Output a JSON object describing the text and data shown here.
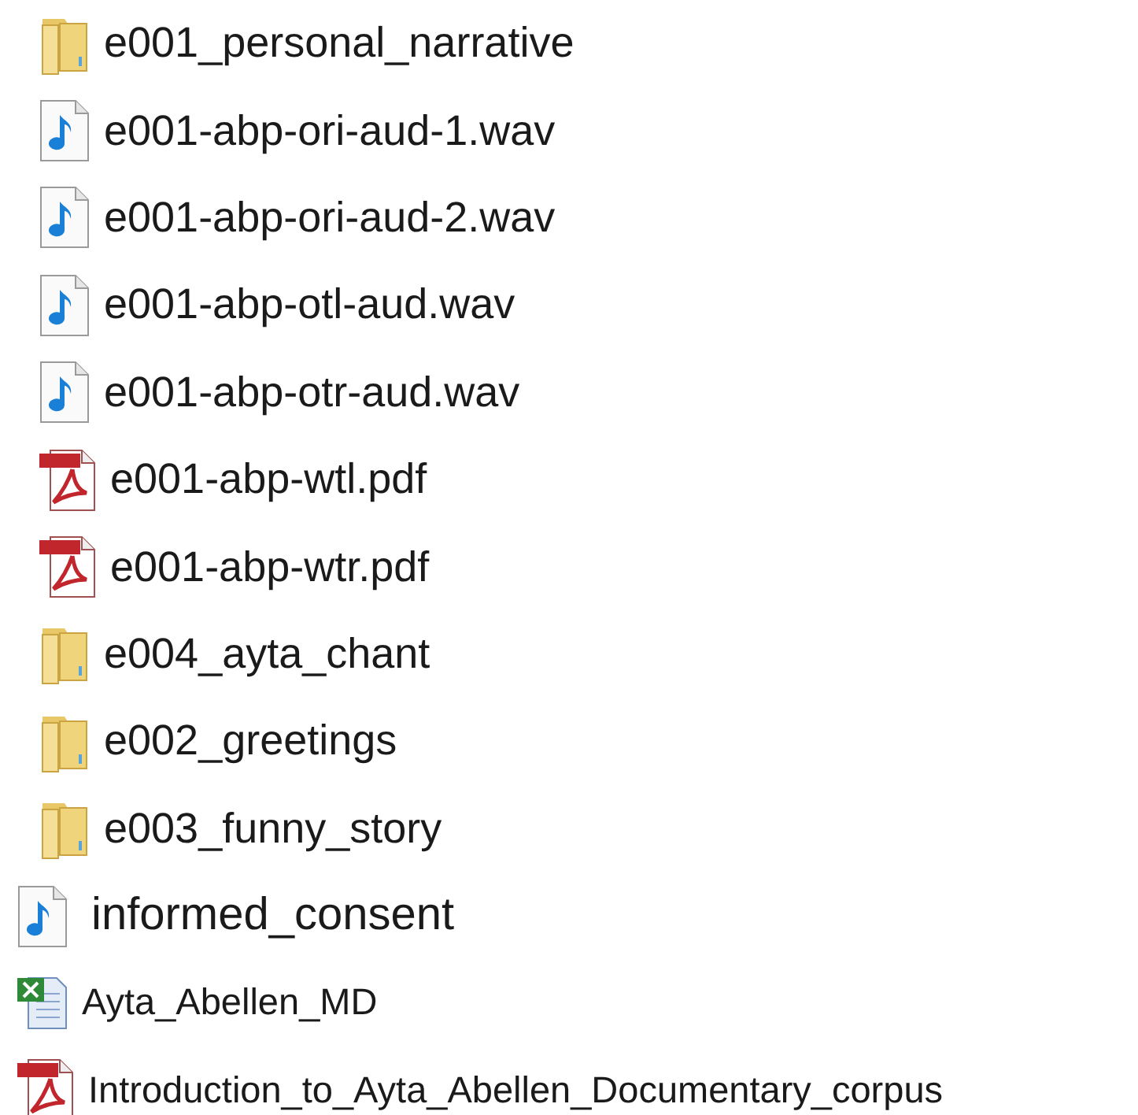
{
  "files": [
    {
      "kind": "folder",
      "name": "e001_personal_narrative"
    },
    {
      "kind": "audio",
      "name": "e001-abp-ori-aud-1.wav"
    },
    {
      "kind": "audio",
      "name": "e001-abp-ori-aud-2.wav"
    },
    {
      "kind": "audio",
      "name": "e001-abp-otl-aud.wav"
    },
    {
      "kind": "audio",
      "name": "e001-abp-otr-aud.wav"
    },
    {
      "kind": "pdf",
      "name": "e001-abp-wtl.pdf"
    },
    {
      "kind": "pdf",
      "name": "e001-abp-wtr.pdf"
    },
    {
      "kind": "folder",
      "name": "e004_ayta_chant"
    },
    {
      "kind": "folder",
      "name": "e002_greetings"
    },
    {
      "kind": "folder",
      "name": "e003_funny_story"
    }
  ],
  "more_files": [
    {
      "kind": "audio",
      "name": "informed_consent"
    },
    {
      "kind": "spreadsheet",
      "name": "Ayta_Abellen_MD"
    },
    {
      "kind": "pdf",
      "name": "Introduction_to_Ayta_Abellen_Documentary_corpus"
    }
  ]
}
